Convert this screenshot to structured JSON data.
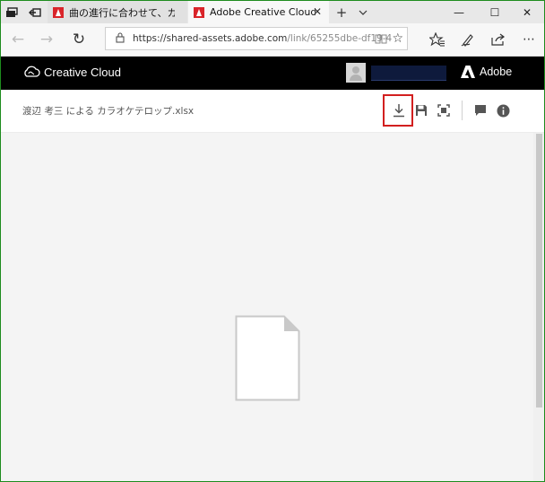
{
  "browser": {
    "tabs": [
      {
        "label": "曲の進行に合わせて、カラオケ字",
        "active": false
      },
      {
        "label": "Adobe Creative Cloud",
        "active": true
      }
    ],
    "new_tab_symbol": "+",
    "tab_list_symbol": "∨",
    "window_controls": {
      "minimize": "—",
      "maximize": "☐",
      "close": "✕"
    },
    "nav": {
      "back": "←",
      "forward": "→",
      "refresh": "↻"
    },
    "url": {
      "host": "https://shared-assets.adobe.com",
      "path": "/link/65255dbe-df19-4"
    },
    "toolbar_icons": [
      "reading-view-icon",
      "favorites-star-icon",
      "favorites-hub-icon",
      "pen-notes-icon",
      "share-icon"
    ]
  },
  "cc_header": {
    "title": "Creative Cloud",
    "brand": "Adobe",
    "user_name_redacted": true
  },
  "file": {
    "name": "渡辺 考三 による カラオケテロップ.xlsx",
    "actions": [
      "download-icon",
      "save-to-cc-icon",
      "fullscreen-icon",
      "comment-icon",
      "info-icon"
    ],
    "highlighted_action": "download-icon"
  },
  "colors": {
    "header_bg": "#000000",
    "highlight": "#d21f1f",
    "window_border": "#1e8c1e",
    "favicon": "#d9242a"
  }
}
